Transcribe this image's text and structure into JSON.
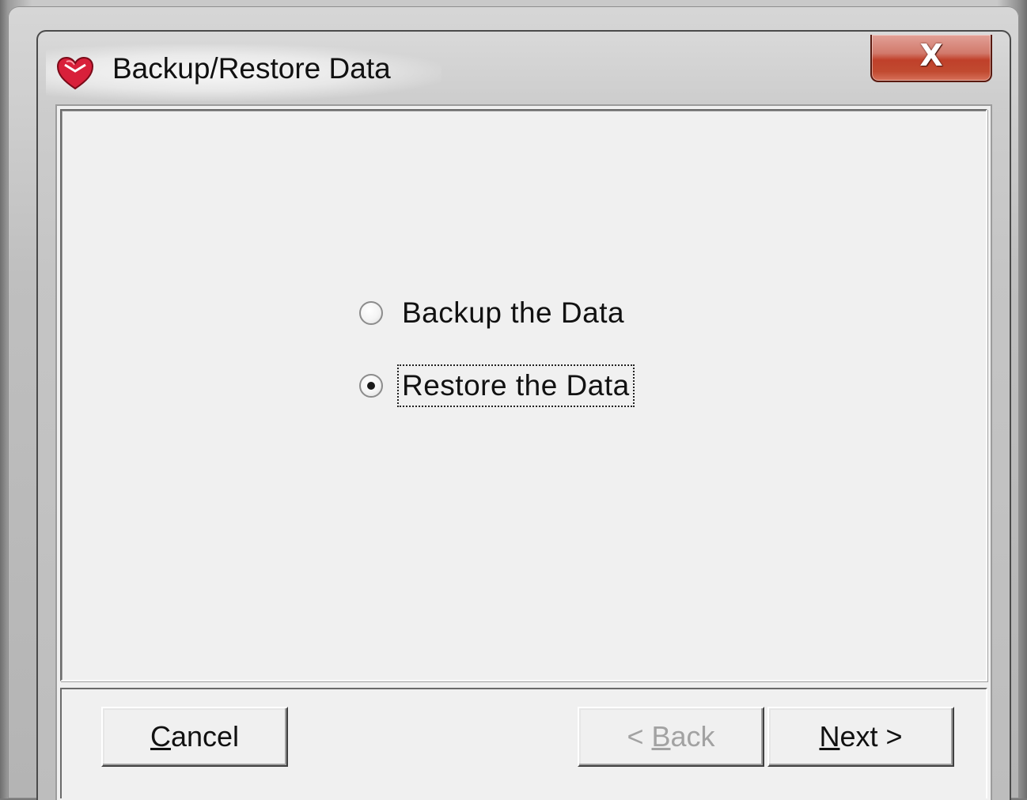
{
  "window": {
    "title": "Backup/Restore Data",
    "close_glyph": "X"
  },
  "options": [
    {
      "label": "Backup the Data",
      "selected": false
    },
    {
      "label": "Restore the Data",
      "selected": true
    }
  ],
  "buttons": {
    "cancel": {
      "mnemonic": "C",
      "rest": "ancel",
      "enabled": true
    },
    "back": {
      "prefix": "< ",
      "mnemonic": "B",
      "rest": "ack",
      "enabled": false
    },
    "next": {
      "mnemonic": "N",
      "rest": "ext >",
      "enabled": true
    }
  },
  "colors": {
    "dialog_background": "#f0f0f0",
    "close_button": "#c0402a",
    "icon_heart": "#d8203a"
  }
}
